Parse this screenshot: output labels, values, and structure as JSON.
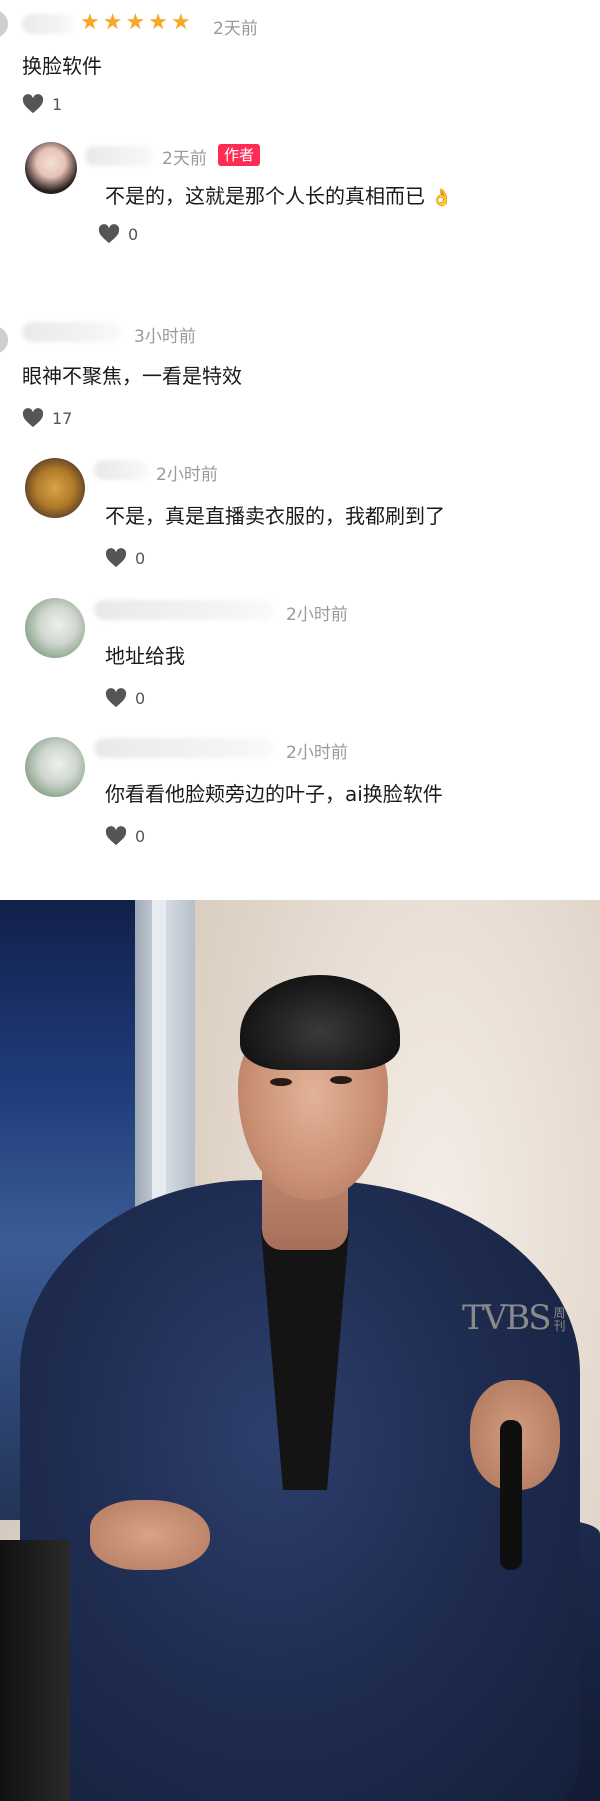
{
  "comments": [
    {
      "time": "2天前",
      "rating_stars": 5,
      "text": "换脸软件",
      "likes": "1",
      "reply": {
        "time": "2天前",
        "badge": "作者",
        "text": "不是的，这就是那个人长的真相而已",
        "emoji": "👌",
        "likes": "0"
      }
    },
    {
      "time": "3小时前",
      "text": "眼神不聚焦，一看是特效",
      "likes": "17",
      "replies": [
        {
          "time": "2小时前",
          "text": "不是，真是直播卖衣服的，我都刷到了",
          "likes": "0"
        },
        {
          "time": "2小时前",
          "text": "地址给我",
          "likes": "0"
        },
        {
          "time": "2小时前",
          "text": "你看看他脸颊旁边的叶子，ai换脸软件",
          "likes": "0"
        }
      ]
    }
  ],
  "photo": {
    "watermark": "TVBS",
    "watermark_sub": "周刊"
  },
  "colors": {
    "star": "#f7a825",
    "badge": "#fe2c55",
    "time": "#9a9a9a",
    "heart": "#555555"
  }
}
